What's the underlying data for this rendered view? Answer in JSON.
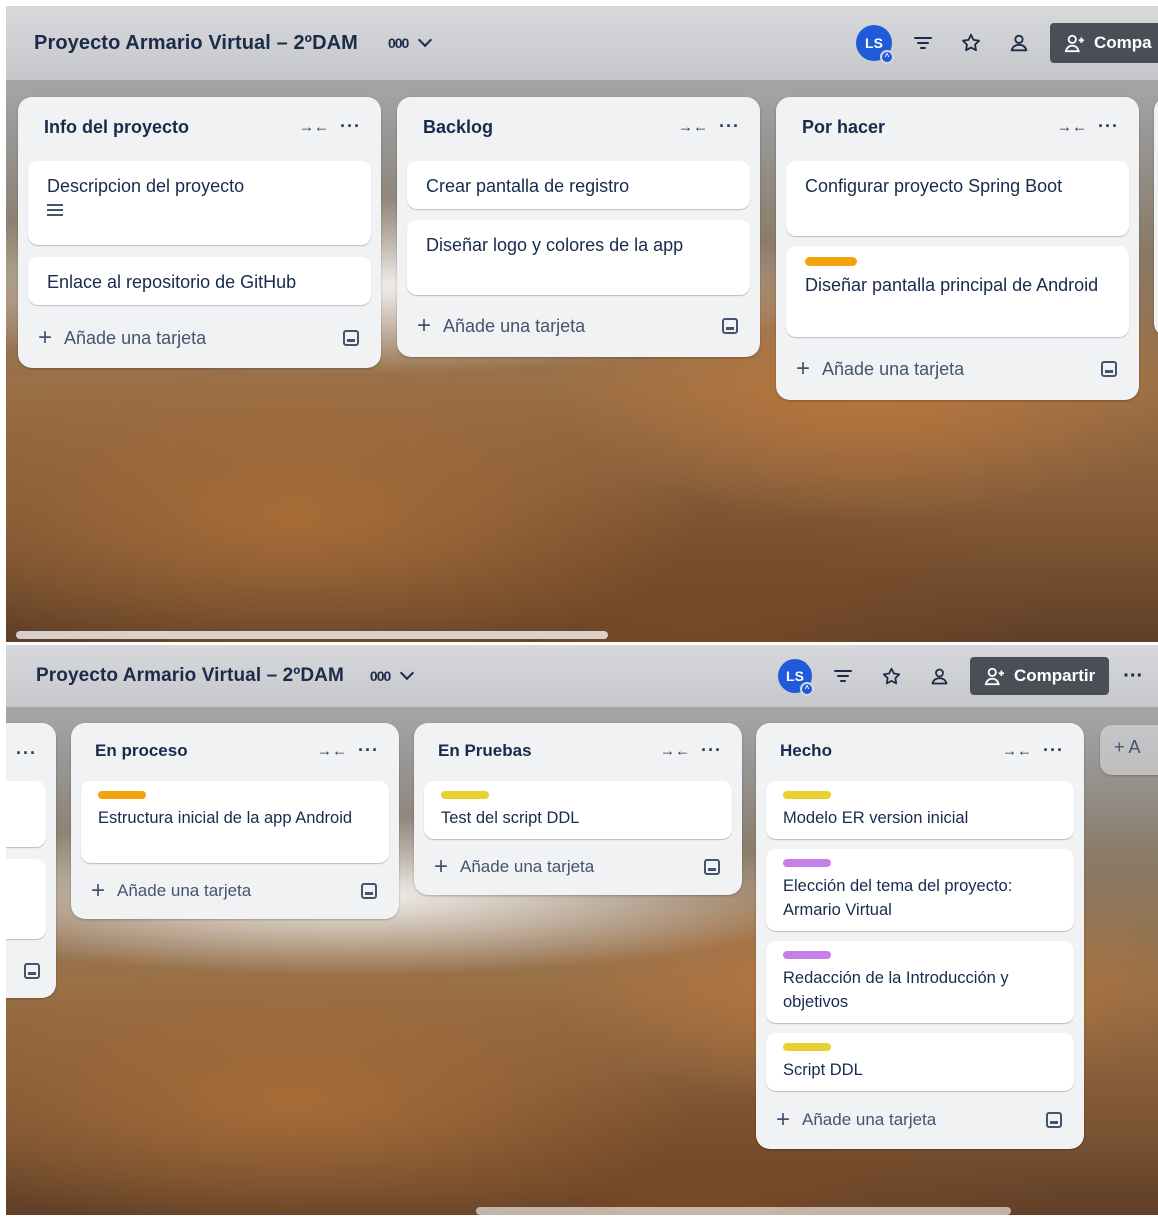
{
  "header_top": {
    "title": "Proyecto Armario Virtual – 2ºDAM",
    "view_glyph": "000",
    "avatar_initials": "LS",
    "share_label": "Compa"
  },
  "header_bottom": {
    "title": "Proyecto Armario Virtual – 2ºDAM",
    "view_glyph": "000",
    "avatar_initials": "LS",
    "share_label": "Compartir",
    "more": "···"
  },
  "colors": {
    "orange": "#f5a30a",
    "yellow": "#e8d12e",
    "purple": "#c77fe8",
    "avatar": "#1f5bd8"
  },
  "lists_top": [
    {
      "title": "Info del proyecto",
      "cards": [
        {
          "text": "Descripcion del proyecto",
          "has_description": true
        },
        {
          "text": "Enlace al repositorio de GitHub"
        }
      ],
      "add_label": "Añade una tarjeta"
    },
    {
      "title": "Backlog",
      "cards": [
        {
          "text": "Crear pantalla de registro"
        },
        {
          "text": "Diseñar logo y colores de la app"
        }
      ],
      "add_label": "Añade una tarjeta"
    },
    {
      "title": "Por hacer",
      "cards": [
        {
          "text": "Configurar proyecto Spring Boot"
        },
        {
          "text": "Diseñar pantalla principal de Android",
          "label": "orange"
        }
      ],
      "add_label": "Añade una tarjeta"
    }
  ],
  "lists_bottom": [
    {
      "title": "En proceso",
      "cards": [
        {
          "text": "Estructura inicial de la app Android",
          "label": "orange"
        }
      ],
      "add_label": "Añade una tarjeta"
    },
    {
      "title": "En Pruebas",
      "cards": [
        {
          "text": "Test del script DDL",
          "label": "yellow"
        }
      ],
      "add_label": "Añade una tarjeta"
    },
    {
      "title": "Hecho",
      "cards": [
        {
          "text": "Modelo ER version inicial",
          "label": "yellow"
        },
        {
          "text": "Elección del tema del proyecto: Armario Virtual",
          "label": "purple"
        },
        {
          "text": "Redacción de la Introducción y objetivos",
          "label": "purple"
        },
        {
          "text": "Script DDL",
          "label": "yellow"
        }
      ],
      "add_label": "Añade una tarjeta"
    }
  ],
  "partial_left_list": {
    "menu": "···"
  },
  "add_list_partial": "+ A"
}
